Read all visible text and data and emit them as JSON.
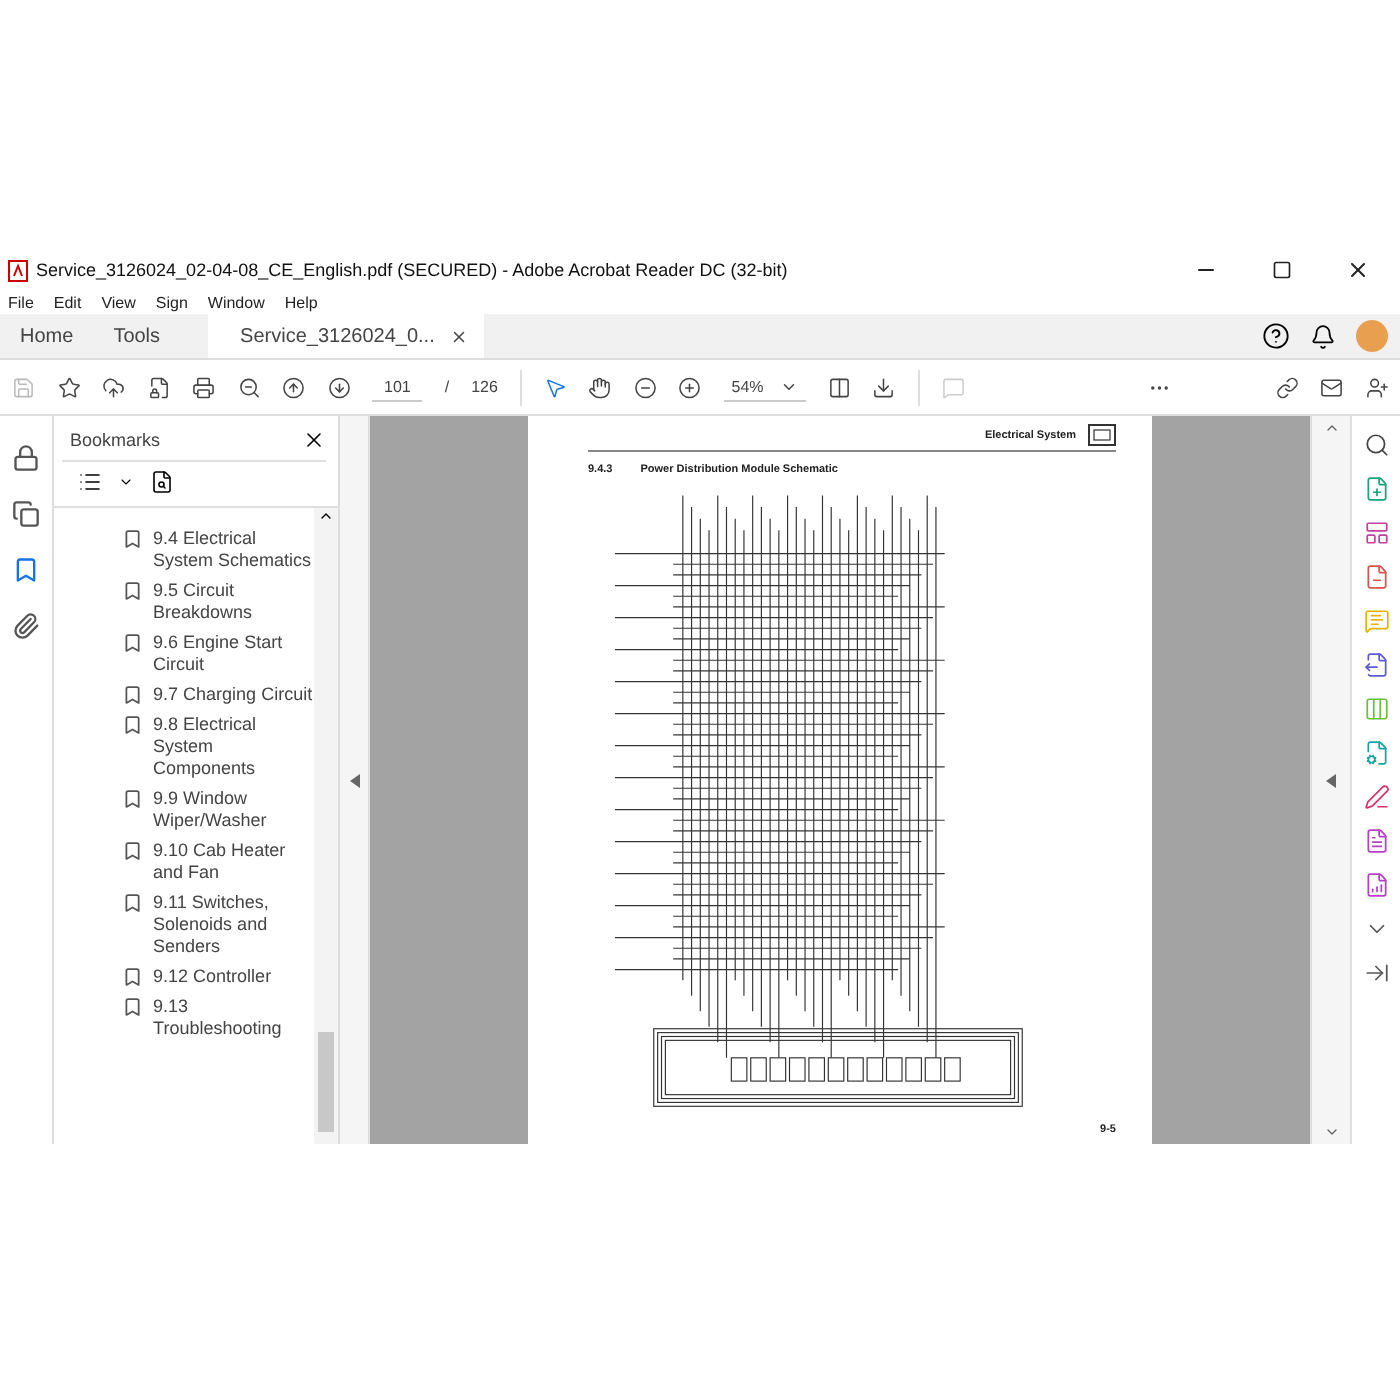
{
  "window": {
    "title": "Service_3126024_02-04-08_CE_English.pdf (SECURED) - Adobe Acrobat Reader DC (32-bit)"
  },
  "menu": [
    "File",
    "Edit",
    "View",
    "Sign",
    "Window",
    "Help"
  ],
  "tabs": [
    {
      "label": "Home",
      "selected": false
    },
    {
      "label": "Tools",
      "selected": false
    },
    {
      "label": "Service_3126024_0...",
      "selected": true,
      "closable": true
    }
  ],
  "toolbar": {
    "page_current": "101",
    "page_separator": "/",
    "page_total": "126",
    "zoom": "54%",
    "comment_disabled": true
  },
  "left_rail": [
    {
      "kind": "lock",
      "selected": false
    },
    {
      "kind": "pages",
      "selected": false
    },
    {
      "kind": "bookmarks",
      "selected": true
    },
    {
      "kind": "attachments",
      "selected": false
    }
  ],
  "bookmarks": {
    "title": "Bookmarks",
    "items": [
      "9.4 Electrical System Schematics",
      "9.5 Circuit Breakdowns",
      "9.6 Engine Start Circuit",
      "9.7 Charging Circuit",
      "9.8 Electrical System Components",
      "9.9 Window Wiper/Washer",
      "9.10 Cab Heater and Fan",
      "9.11 Switches, Solenoids and Senders",
      "9.12 Controller",
      "9.13 Troubleshooting"
    ]
  },
  "document": {
    "header": "Electrical System",
    "section_number": "9.4.3",
    "section_title": "Power Distribution Module Schematic",
    "page_number": "9-5"
  }
}
